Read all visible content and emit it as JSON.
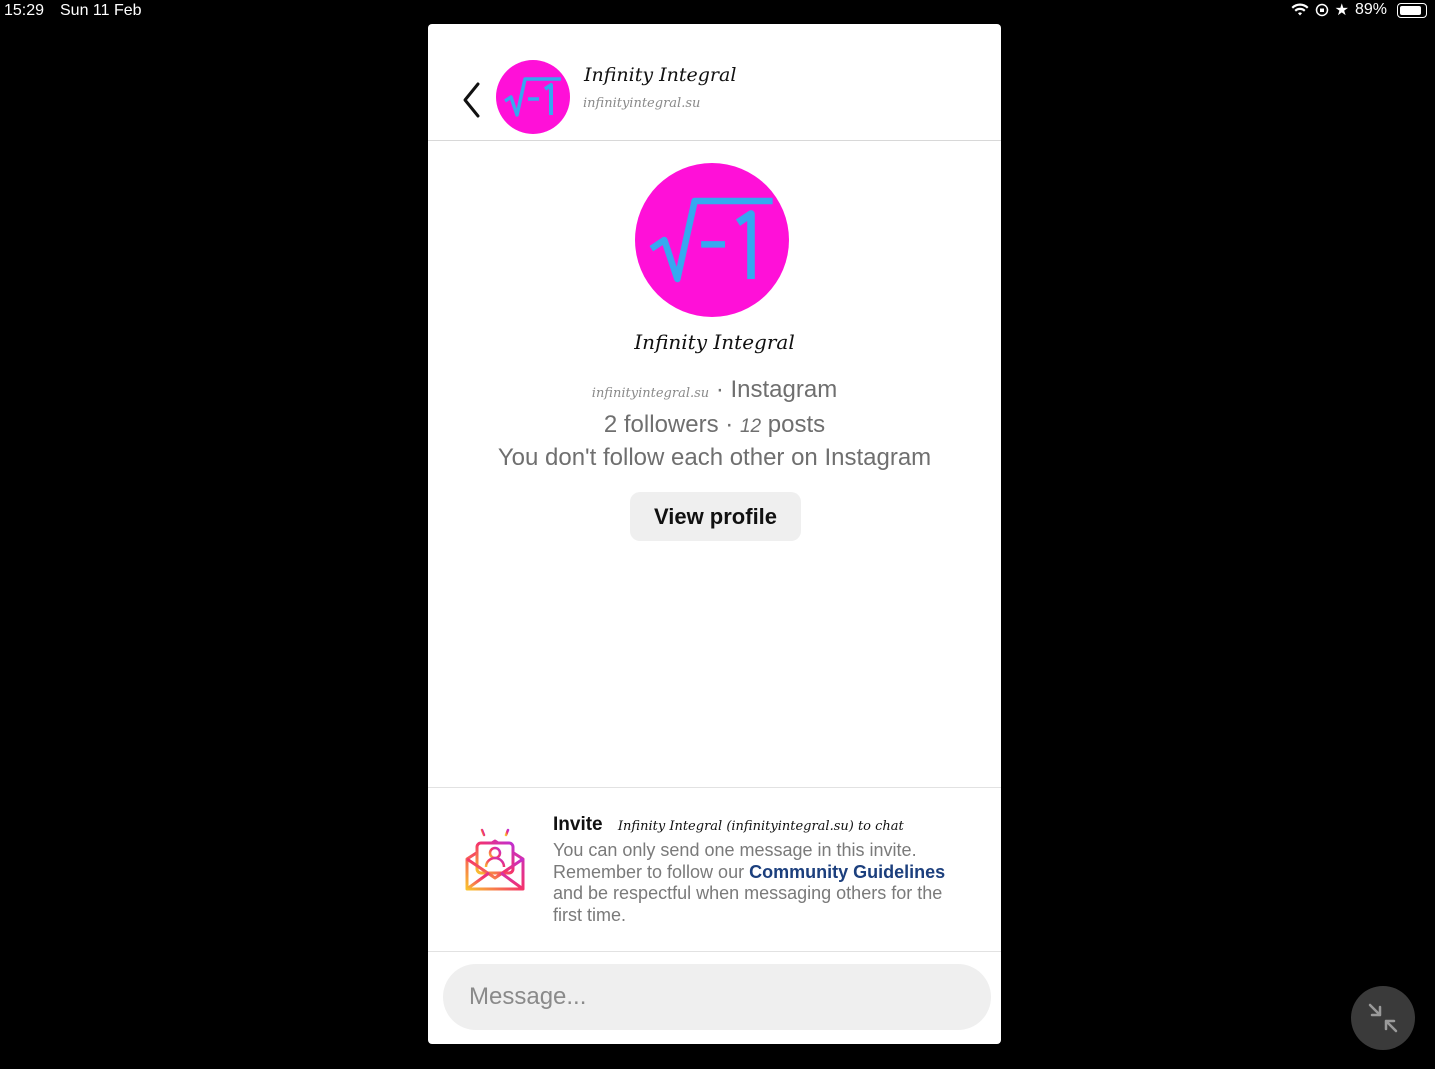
{
  "status_bar": {
    "time": "15:29",
    "date": "Sun 11 Feb",
    "battery": "89%",
    "battery_level": 0.89
  },
  "header": {
    "name": "Infinity Integral",
    "handle": "infinityintegral.su",
    "avatar_text": "√−1"
  },
  "profile": {
    "name": "Infinity Integral",
    "handle": "infinityintegral.su",
    "platform": "Instagram",
    "followers_count": "2",
    "followers_label": "followers",
    "posts_count": "12",
    "posts_label": "posts",
    "follow_status": "You don't follow each other on Instagram",
    "view_profile_label": "View profile"
  },
  "invite": {
    "label": "Invite",
    "name_text": "Infinity Integral (infinityintegral.su) to chat",
    "body_part1": "You can only send one message in this invite. Remember to follow our ",
    "link_text": "Community Guidelines",
    "body_part2": " and be respectful when messaging others for the first time."
  },
  "composer": {
    "placeholder": "Message..."
  },
  "colors": {
    "avatar_bg": "#ff10d8",
    "avatar_symbol": "#35a8f0",
    "link": "#1c3f7d"
  }
}
